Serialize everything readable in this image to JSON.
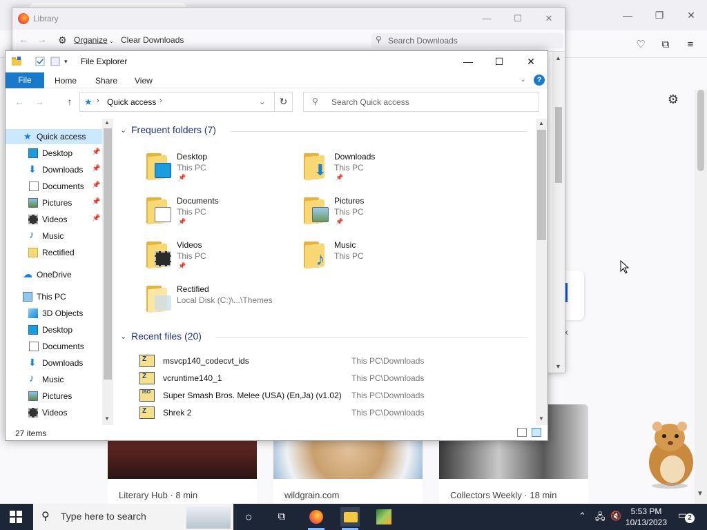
{
  "library": {
    "title": "Library",
    "organize_label": "Organize",
    "clear_downloads_label": "Clear Downloads",
    "search_placeholder": "Search Downloads"
  },
  "explorer": {
    "title": "File Explorer",
    "ribbon_tabs": [
      "File",
      "Home",
      "Share",
      "View"
    ],
    "address": "Quick access",
    "search_placeholder": "Search Quick access",
    "nav_items": [
      {
        "label": "Quick access",
        "icon": "star-icon",
        "selected": true,
        "pinned": false
      },
      {
        "label": "Desktop",
        "icon": "desktop-icon",
        "pinned": true
      },
      {
        "label": "Downloads",
        "icon": "download-arrow-icon",
        "pinned": true
      },
      {
        "label": "Documents",
        "icon": "document-icon",
        "pinned": true
      },
      {
        "label": "Pictures",
        "icon": "pictures-icon",
        "pinned": true
      },
      {
        "label": "Videos",
        "icon": "film-icon",
        "pinned": true
      },
      {
        "label": "Music",
        "icon": "music-note-icon",
        "pinned": false
      },
      {
        "label": "Rectified",
        "icon": "folder-icon",
        "pinned": false
      },
      {
        "label": "OneDrive",
        "icon": "cloud-icon",
        "pinned": false
      },
      {
        "label": "This PC",
        "icon": "computer-icon",
        "pinned": false
      },
      {
        "label": "3D Objects",
        "icon": "cube-icon",
        "pinned": false
      },
      {
        "label": "Desktop",
        "icon": "desktop-icon",
        "pinned": false
      },
      {
        "label": "Documents",
        "icon": "document-icon",
        "pinned": false
      },
      {
        "label": "Downloads",
        "icon": "download-arrow-icon",
        "pinned": false
      },
      {
        "label": "Music",
        "icon": "music-note-icon",
        "pinned": false
      },
      {
        "label": "Pictures",
        "icon": "pictures-icon",
        "pinned": false
      },
      {
        "label": "Videos",
        "icon": "film-icon",
        "pinned": false
      }
    ],
    "frequent_header": "Frequent folders (7)",
    "frequent_folders": [
      {
        "name": "Desktop",
        "location": "This PC",
        "pinned": true
      },
      {
        "name": "Downloads",
        "location": "This PC",
        "pinned": true
      },
      {
        "name": "Documents",
        "location": "This PC",
        "pinned": true
      },
      {
        "name": "Pictures",
        "location": "This PC",
        "pinned": true
      },
      {
        "name": "Videos",
        "location": "This PC",
        "pinned": true
      },
      {
        "name": "Music",
        "location": "This PC",
        "pinned": false
      },
      {
        "name": "Rectified",
        "location": "Local Disk (C:)\\...\\Themes",
        "pinned": false
      }
    ],
    "recent_header": "Recent files (20)",
    "recent_files": [
      {
        "name": "msvcp140_codecvt_ids",
        "path": "This PC\\Downloads",
        "icon_glyph": "Z"
      },
      {
        "name": "vcruntime140_1",
        "path": "This PC\\Downloads",
        "icon_glyph": "Z"
      },
      {
        "name": "Super Smash Bros. Melee (USA) (En,Ja) (v1.02)",
        "path": "This PC\\Downloads",
        "icon_glyph": "ISO"
      },
      {
        "name": "Shrek 2",
        "path": "This PC\\Downloads",
        "icon_glyph": "Z"
      }
    ],
    "status": "27 items"
  },
  "browser": {
    "stories": [
      {
        "caption": "Literary Hub · 8 min"
      },
      {
        "caption": "wildgrain.com"
      },
      {
        "caption": "Collectors Weekly · 18 min"
      }
    ],
    "fragment_text": "x"
  },
  "taskbar": {
    "search_placeholder": "Type here to search",
    "time": "5:53 PM",
    "date": "10/13/2023",
    "notification_count": "2"
  },
  "colors": {
    "accent": "#1979ca",
    "selection": "#cce8ff",
    "section_header": "#1e3287",
    "taskbar": "#1c2636"
  }
}
